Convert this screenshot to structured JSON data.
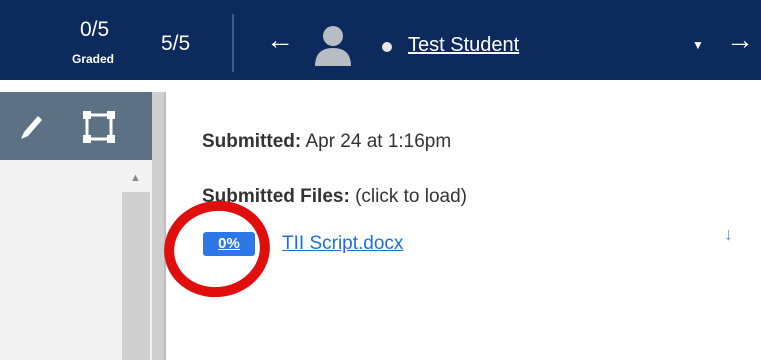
{
  "header": {
    "graded_count": "0/5",
    "graded_label": "Graded",
    "student_position": "5/5",
    "student_name": "Test Student"
  },
  "submission": {
    "submitted_label": "Submitted:",
    "submitted_date": " Apr 24 at 1:16pm",
    "files_label": "Submitted Files:",
    "files_hint": " (click to load)",
    "files": [
      {
        "score": "0%",
        "name": "TII Script.docx"
      }
    ]
  },
  "icons": {
    "prev": "arrow-left",
    "next": "arrow-right",
    "avatar": "user-avatar",
    "pencil": "pencil",
    "select": "selection-box",
    "download": "download-arrow"
  },
  "colors": {
    "header_bg": "#0d2a5c",
    "toolbar_bg": "#5c7284",
    "badge": "#2e77e6",
    "link": "#1e6fd9",
    "annotation": "#e10e0e"
  }
}
